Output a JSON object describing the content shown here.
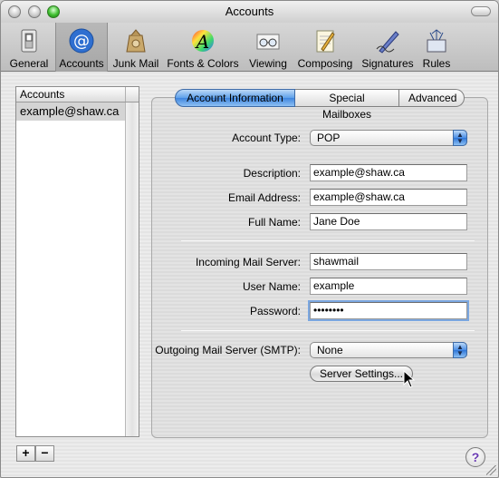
{
  "window": {
    "title": "Accounts"
  },
  "toolbar": {
    "items": [
      {
        "label": "General",
        "icon": "switch-icon"
      },
      {
        "label": "Accounts",
        "icon": "at-sign-icon"
      },
      {
        "label": "Junk Mail",
        "icon": "junk-mail-bag-icon"
      },
      {
        "label": "Fonts & Colors",
        "icon": "fonts-colors-icon"
      },
      {
        "label": "Viewing",
        "icon": "glasses-icon"
      },
      {
        "label": "Composing",
        "icon": "pencil-paper-icon"
      },
      {
        "label": "Signatures",
        "icon": "pen-signature-icon"
      },
      {
        "label": "Rules",
        "icon": "rules-arrows-icon"
      }
    ],
    "selected": "Accounts"
  },
  "accounts_list": {
    "header": "Accounts",
    "items": [
      "example@shaw.ca"
    ]
  },
  "list_buttons": {
    "add": "+",
    "remove": "−"
  },
  "tabs": [
    "Account Information",
    "Special Mailboxes",
    "Advanced"
  ],
  "active_tab": "Account Information",
  "form": {
    "account_type": {
      "label": "Account Type:",
      "value": "POP"
    },
    "description": {
      "label": "Description:",
      "value": "example@shaw.ca"
    },
    "email_address": {
      "label": "Email Address:",
      "value": "example@shaw.ca"
    },
    "full_name": {
      "label": "Full Name:",
      "value": "Jane Doe"
    },
    "incoming_server": {
      "label": "Incoming Mail Server:",
      "value": "shawmail"
    },
    "user_name": {
      "label": "User Name:",
      "value": "example"
    },
    "password": {
      "label": "Password:",
      "value": "••••••••"
    },
    "outgoing_server": {
      "label": "Outgoing Mail Server (SMTP):",
      "value": "None"
    },
    "server_settings_button": "Server Settings..."
  },
  "help_button": "?",
  "colors": {
    "accent": "#3f86df",
    "selection": "#d4d4d4"
  }
}
